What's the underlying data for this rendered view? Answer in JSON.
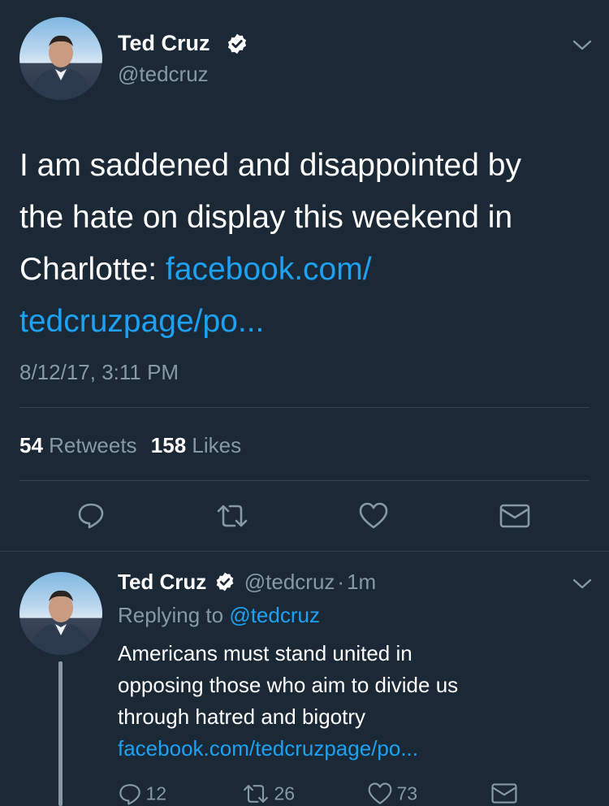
{
  "main_tweet": {
    "author_name": "Ted Cruz",
    "handle": "@tedcruz",
    "text_line1": "I am saddened and disappointed by",
    "text_line2": "the hate on display this weekend in",
    "text_line3_plain": "Charlotte: ",
    "text_line3_link": "facebook.com/",
    "text_line4_link": "tedcruzpage/po...",
    "timestamp": "8/12/17, 3:11 PM",
    "retweets_count": "54",
    "retweets_label": "Retweets",
    "likes_count": "158",
    "likes_label": "Likes"
  },
  "reply_tweet": {
    "author_name": "Ted Cruz",
    "handle": "@tedcruz",
    "separator": "·",
    "time": "1m",
    "replying_prefix": "Replying to",
    "replying_handle": "@tedcruz",
    "text_line1": "Americans must stand united in",
    "text_line2": "opposing those who aim to divide us",
    "text_line3": "through hatred and bigotry",
    "text_line4_link": "facebook.com/tedcruzpage/po...",
    "reply_count": "12",
    "retweet_count": "26",
    "like_count": "73"
  },
  "icons": {
    "verified": "verified-badge-icon",
    "menu": "chevron-down-icon",
    "reply": "reply-icon",
    "retweet": "retweet-icon",
    "like": "heart-icon",
    "dm": "envelope-icon"
  },
  "colors": {
    "background": "#1b2836",
    "link": "#1da1f2",
    "muted": "#8899a6",
    "divider": "#38444d"
  }
}
